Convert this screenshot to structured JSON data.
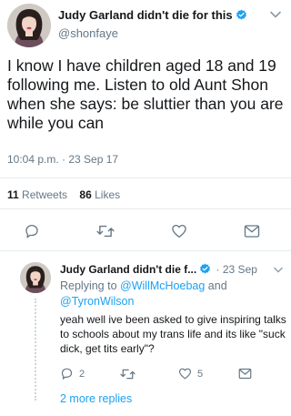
{
  "tweet": {
    "display_name": "Judy Garland didn't die for this",
    "handle": "@shonfaye",
    "text": "I know I have children aged 18 and 19 following me. Listen to old Aunt Shon when she says: be sluttier than you are while you can",
    "timestamp": "10:04 p.m. · 23 Sep 17",
    "retweets_count": "11",
    "retweets_label": "Retweets",
    "likes_count": "86",
    "likes_label": "Likes"
  },
  "reply": {
    "display_name": "Judy Garland didn't die f...",
    "date": "· 23 Sep",
    "replying_prefix": "Replying to",
    "mention_1": "@WillMcHoebag",
    "and_word": "and",
    "mention_2": "@TyronWilson",
    "text": "yeah well ive been asked to give inspiring talks to schools about my trans life and its like \"suck dick, get tits early\"?",
    "reply_count": "2",
    "like_count": "5",
    "more_replies": "2 more replies"
  },
  "icons": {
    "verified": "verified-badge-icon",
    "chevron": "chevron-down-icon",
    "reply": "reply-icon",
    "retweet": "retweet-icon",
    "like": "heart-icon",
    "message": "envelope-icon"
  },
  "colors": {
    "accent": "#1da1f2",
    "text": "#14171a",
    "secondary": "#657786"
  }
}
